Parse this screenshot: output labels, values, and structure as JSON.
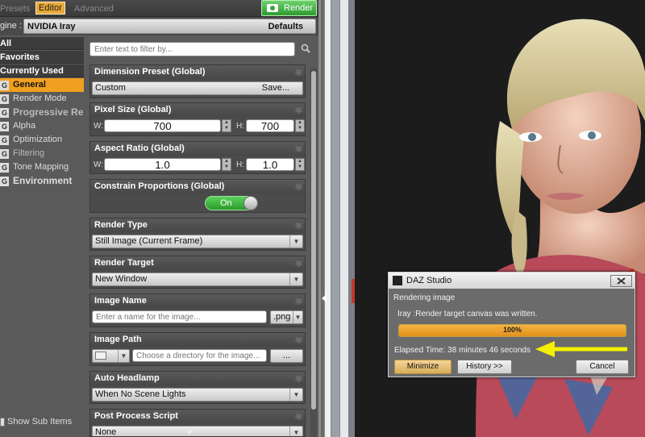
{
  "tabs": [
    "Presets",
    "Editor",
    "Advanced"
  ],
  "render_button": "Render",
  "engine": {
    "label": "gine :",
    "value": "NVIDIA Iray",
    "defaults": "Defaults"
  },
  "nav": {
    "all": "All",
    "favorites": "Favorites",
    "currently_used": "Currently Used",
    "items": [
      {
        "g": "G",
        "label": "General"
      },
      {
        "g": "G",
        "label": "Render Mode"
      },
      {
        "g": "G",
        "label": "Progressive Re..."
      },
      {
        "g": "G",
        "label": "Alpha"
      },
      {
        "g": "G",
        "label": "Optimization"
      },
      {
        "g": "G",
        "label": "Filtering"
      },
      {
        "g": "G",
        "label": "Tone Mapping"
      },
      {
        "g": "G",
        "label": "Environment"
      }
    ],
    "show_sub_items": "Show Sub Items"
  },
  "filter_placeholder": "Enter text to filter by...",
  "props": {
    "dimension_preset": {
      "title": "Dimension Preset (Global)",
      "value": "Custom",
      "save": "Save..."
    },
    "pixel_size": {
      "title": "Pixel Size (Global)",
      "w_label": "W:",
      "w": "700",
      "h_label": "H:",
      "h": "700"
    },
    "aspect_ratio": {
      "title": "Aspect Ratio (Global)",
      "w_label": "W:",
      "w": "1.0",
      "h_label": "H:",
      "h": "1.0"
    },
    "constrain": {
      "title": "Constrain Proportions (Global)",
      "value": "On"
    },
    "render_type": {
      "title": "Render Type",
      "value": "Still Image (Current Frame)"
    },
    "render_target": {
      "title": "Render Target",
      "value": "New Window"
    },
    "image_name": {
      "title": "Image Name",
      "placeholder": "Enter a name for the image...",
      "ext": ".png"
    },
    "image_path": {
      "title": "Image Path",
      "placeholder": "Choose a directory for the image...",
      "browse": "..."
    },
    "auto_headlamp": {
      "title": "Auto Headlamp",
      "value": "When No Scene Lights"
    },
    "post_process": {
      "title": "Post Process Script",
      "value": "None"
    }
  },
  "dialog": {
    "title": "DAZ Studio",
    "status": "Rendering image",
    "message": "Iray :Render target canvas was written.",
    "progress": 100,
    "progress_text": "100%",
    "elapsed": "Elapsed Time:  38 minutes 46 seconds",
    "buttons": {
      "minimize": "Minimize",
      "history": "History >>",
      "cancel": "Cancel"
    }
  },
  "colors": {
    "accent": "#f0a020",
    "render": "#3aa43a",
    "arrow": "#f5f000"
  }
}
